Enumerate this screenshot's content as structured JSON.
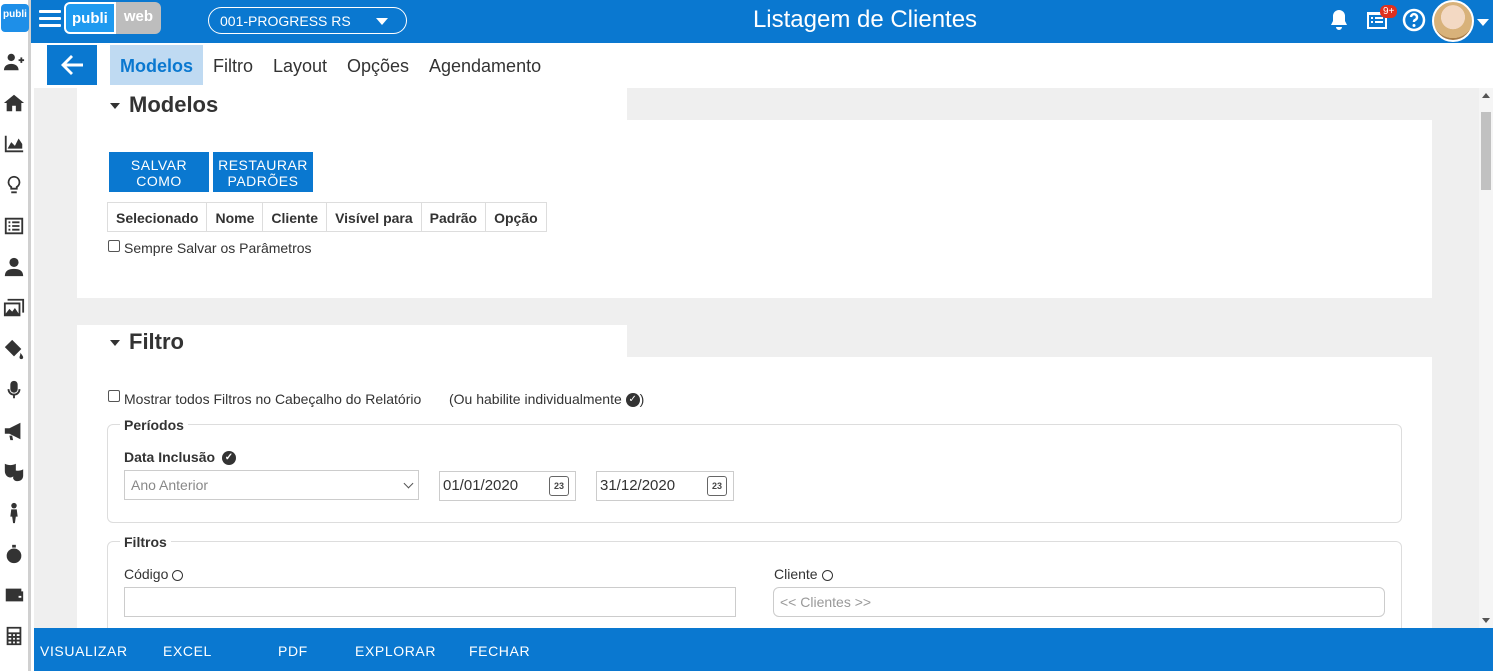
{
  "header": {
    "brand_part1": "publi",
    "brand_part2": "web",
    "company": "001-PROGRESS RS",
    "title": "Listagem de Clientes",
    "notifications_badge": "9+",
    "sidebar_logo": "publi",
    "colors": {
      "primary": "#0a78d0",
      "tab_active_bg": "#bfdaf2",
      "badge": "#e0301e"
    }
  },
  "tabs": [
    {
      "label": "Modelos",
      "active": true
    },
    {
      "label": "Filtro",
      "active": false
    },
    {
      "label": "Layout",
      "active": false
    },
    {
      "label": "Opções",
      "active": false
    },
    {
      "label": "Agendamento",
      "active": false
    }
  ],
  "modelos": {
    "title": "Modelos",
    "save_as_label": "SALVAR COMO",
    "restore_label": "RESTAURAR PADRÕES",
    "columns": [
      "Selecionado",
      "Nome",
      "Cliente",
      "Visível para",
      "Padrão",
      "Opção"
    ],
    "always_save_label": "Sempre Salvar os Parâmetros"
  },
  "filtro": {
    "title": "Filtro",
    "show_all_label": "Mostrar todos Filtros no Cabeçalho do Relatório",
    "individually_label": "(Ou habilite individualmente",
    "individually_close": ")",
    "periodos": {
      "legend": "Períodos",
      "data_inclusao_label": "Data Inclusão",
      "period_select": "Ano Anterior",
      "date_from": "01/01/2020",
      "date_to": "31/12/2020",
      "calendar_day": "23"
    },
    "filtros": {
      "legend": "Filtros",
      "codigo_label": "Código",
      "codigo_value": "",
      "cliente_label": "Cliente",
      "cliente_placeholder": "<< Clientes >>"
    }
  },
  "footer": {
    "buttons": [
      "VISUALIZAR",
      "EXCEL",
      "PDF",
      "EXPLORAR",
      "FECHAR"
    ]
  }
}
